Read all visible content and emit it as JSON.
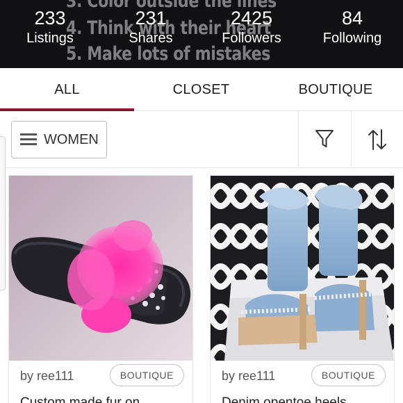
{
  "banner": {
    "lines": [
      "3. Color outside the lines",
      "4. Think with their heart",
      "5. Make lots of mistakes"
    ]
  },
  "stats": [
    {
      "value": "233",
      "label": "Listings"
    },
    {
      "value": "231",
      "label": "Shares"
    },
    {
      "value": "2425",
      "label": "Followers"
    },
    {
      "value": "84",
      "label": "Following"
    }
  ],
  "tabs": {
    "active": "ALL",
    "items": [
      "ALL",
      "CLOSET",
      "BOUTIQUE"
    ],
    "accent_color": "#7d1d2a"
  },
  "filter": {
    "department": "WOMEN",
    "filter_icon": "funnel-icon",
    "sort_icon": "sort-arrows-icon"
  },
  "listings": [
    {
      "seller": "by ree111",
      "badge": "BOUTIQUE",
      "title": "Custom made fur on"
    },
    {
      "seller": "by ree111",
      "badge": "BOUTIQUE",
      "title": "Denim opentoe heels"
    }
  ]
}
